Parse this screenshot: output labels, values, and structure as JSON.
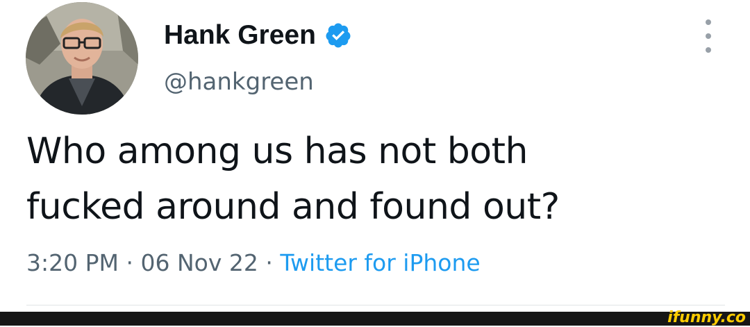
{
  "tweet": {
    "author": {
      "display_name": "Hank Green",
      "handle": "@hankgreen",
      "verified": true
    },
    "text_lines": [
      "Who among us has not both",
      "fucked around and found out?"
    ],
    "time": "3:20 PM",
    "separator": "·",
    "date": "06 Nov 22",
    "source": "Twitter for iPhone"
  },
  "watermark": "ifunny.co",
  "icons": {
    "verified": "verified-badge-icon",
    "more": "more-vertical-icon"
  },
  "colors": {
    "accent": "#1d9bf0",
    "text": "#0f1419",
    "secondary": "#536471",
    "watermark": "#ffcc00"
  }
}
